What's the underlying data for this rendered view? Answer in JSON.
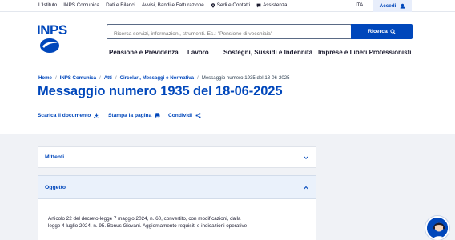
{
  "topbar": {
    "links": [
      "L'Istituto",
      "INPS Comunica",
      "Dati e Bilanci",
      "Avvisi, Bandi e Fatturazione",
      "Sedi e Contatti",
      "Assistenza"
    ],
    "lang": "ITA",
    "login_label": "Accedi"
  },
  "header": {
    "logo_text": "INPS",
    "search_placeholder": "Ricerca servizi, informazioni, strumenti. Es.: \"Pensione di vecchiaia\"",
    "search_button": "Ricerca"
  },
  "nav": {
    "items": [
      "Pensione e Previdenza",
      "Lavoro",
      "Sostegni, Sussidi e Indennità",
      "Imprese e Liberi Professionisti"
    ]
  },
  "breadcrumb": {
    "items": [
      "Home",
      "INPS Comunica",
      "Atti",
      "Circolari, Messaggi e Normativa"
    ],
    "current": "Messaggio numero 1935 del 18-06-2025"
  },
  "page": {
    "title": "Messaggio numero 1935 del 18-06-2025"
  },
  "actions": {
    "download": "Scarica il documento",
    "print": "Stampa la pagina",
    "share": "Condividi"
  },
  "accordion": {
    "mittenti_label": "Mittenti",
    "oggetto_label": "Oggetto",
    "oggetto_text": "Articolo 22 del decreto-legge 7 maggio 2024, n. 60, convertito, con modificazioni, dalla legge 4 luglio 2024, n. 95. Bonus Giovani. Aggiornamento requisiti e indicazioni operative"
  },
  "colors": {
    "brand_blue": "#0047bb",
    "panel_bg": "#f0f2f6",
    "active_accordion": "#eaf1fb"
  }
}
